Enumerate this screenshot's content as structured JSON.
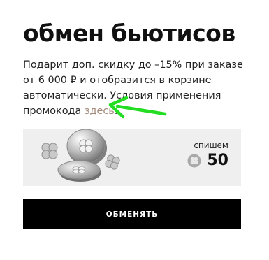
{
  "header": {
    "title": "обмен бьютисов"
  },
  "description": {
    "text": "Подарит доп. скидку до –15% при заказе от 6 000 ₽ и отобразится в корзине автоматически. Условия применения промокода ",
    "link_label": "здесь",
    "suffix": "."
  },
  "annotation": {
    "arrow_color": "#22dd22",
    "icon": "arrow-icon"
  },
  "card": {
    "image_icon": "coins-icon",
    "spend_label": "спишем",
    "coin_icon": "coin-icon",
    "spend_value": "50"
  },
  "action": {
    "button_label": "ОБМЕНЯТЬ"
  },
  "colors": {
    "accent_link": "#a3897a",
    "button_bg": "#000000",
    "card_bg": "#efefef"
  }
}
